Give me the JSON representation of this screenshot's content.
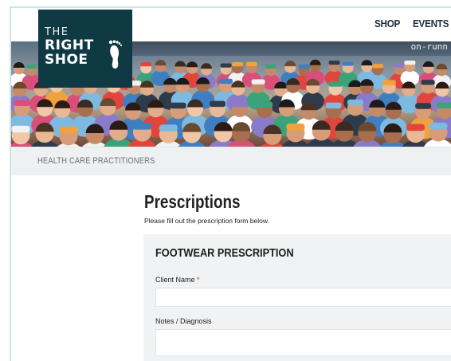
{
  "nav": {
    "items": [
      {
        "label": "SHOP"
      },
      {
        "label": "EVENTS"
      }
    ]
  },
  "logo": {
    "line1": "THE",
    "line2": "RIGHT",
    "line3": "SHOE",
    "icon": "footprint-icon"
  },
  "hero": {
    "banner_text": "on-runn"
  },
  "subheader": {
    "label": "HEALTH CARE PRACTITIONERS"
  },
  "page": {
    "title": "Prescriptions",
    "intro": "Please fill out the prescription form below."
  },
  "form": {
    "title": "FOOTWEAR PRESCRIPTION",
    "client_name": {
      "label": "Client Name",
      "required_mark": "*",
      "value": ""
    },
    "notes": {
      "label": "Notes / Diagnosis",
      "value": ""
    }
  },
  "colors": {
    "logo_bg": "#0f3a44",
    "required": "#d0342c",
    "subbar_bg": "#eef0f1",
    "card_bg": "#f1f2f3"
  }
}
